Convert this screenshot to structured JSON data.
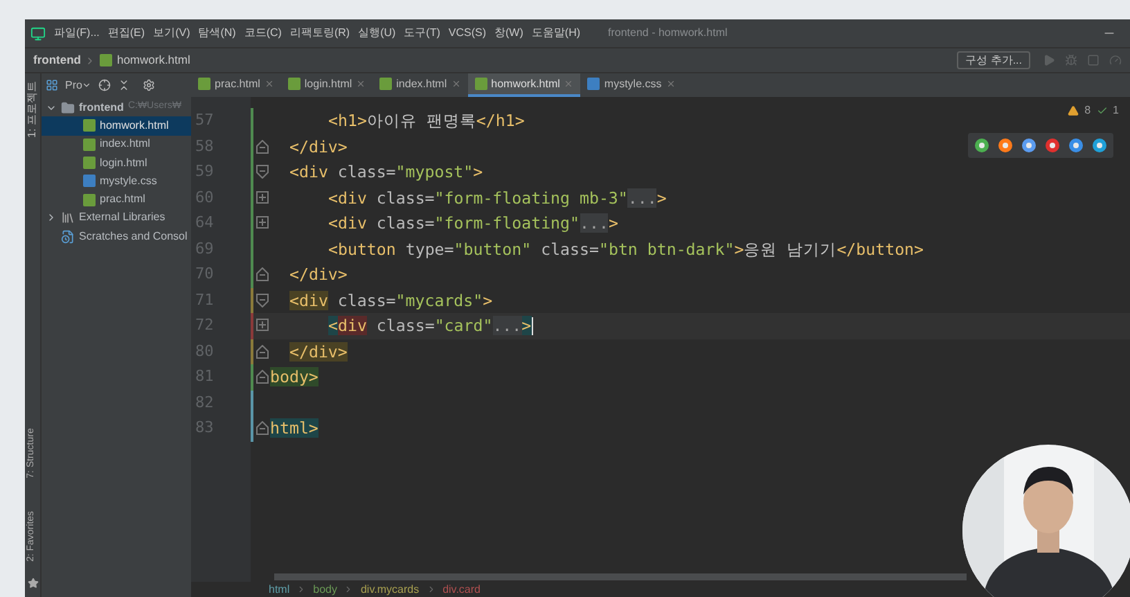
{
  "window": {
    "title": "frontend - homwork.html",
    "menu": [
      "파일(F)...",
      "편집(E)",
      "보기(V)",
      "탐색(N)",
      "코드(C)",
      "리팩토링(R)",
      "실행(U)",
      "도구(T)",
      "VCS(S)",
      "창(W)",
      "도움말(H)"
    ]
  },
  "breadcrumb": [
    "frontend",
    "homwork.html"
  ],
  "toolbar": {
    "config_button": "구성 추가..."
  },
  "tool_strip": {
    "top": "1: 프로젝트",
    "bottom": [
      "7: Structure",
      "2: Favorites"
    ]
  },
  "project": {
    "view_label": "Pro",
    "tree": [
      {
        "label": "frontend",
        "path": "C:₩Users₩",
        "kind": "folder",
        "expanded": true,
        "selected": false,
        "children": [
          {
            "label": "homwork.html",
            "kind": "html",
            "selected": true
          },
          {
            "label": "index.html",
            "kind": "html",
            "selected": false
          },
          {
            "label": "login.html",
            "kind": "html",
            "selected": false
          },
          {
            "label": "mystyle.css",
            "kind": "css",
            "selected": false
          },
          {
            "label": "prac.html",
            "kind": "html",
            "selected": false
          }
        ]
      },
      {
        "label": "External Libraries",
        "kind": "library",
        "expanded": false,
        "selected": false
      },
      {
        "label": "Scratches and Consol",
        "kind": "scratch",
        "selected": false
      }
    ]
  },
  "tabs": [
    {
      "label": "prac.html",
      "kind": "html",
      "selected": false
    },
    {
      "label": "login.html",
      "kind": "html",
      "selected": false
    },
    {
      "label": "index.html",
      "kind": "html",
      "selected": false
    },
    {
      "label": "homwork.html",
      "kind": "html",
      "selected": true
    },
    {
      "label": "mystyle.css",
      "kind": "css",
      "selected": false
    }
  ],
  "inspections": {
    "warnings": "8",
    "checks": "1"
  },
  "code": [
    {
      "number": "57",
      "indent": {
        "kind": "inner"
      },
      "change_bar": {
        "color": "#4f8a4f"
      },
      "current": false,
      "tokens": [
        {
          "kind": "tag",
          "text": "<h1>"
        },
        {
          "kind": "text",
          "text": "아이유 팬명록"
        },
        {
          "kind": "tag",
          "text": "</h1>"
        }
      ]
    },
    {
      "number": "58",
      "indent": {
        "kind": "outer"
      },
      "fold": {
        "kind": "end"
      },
      "change_bar": {
        "color": "#4f8a4f"
      },
      "current": false,
      "tokens": [
        {
          "kind": "tag",
          "text": "</div>"
        }
      ]
    },
    {
      "number": "59",
      "indent": {
        "kind": "outer"
      },
      "fold": {
        "kind": "start"
      },
      "change_bar": {
        "color": "#4f8a4f"
      },
      "current": false,
      "tokens": [
        {
          "kind": "tag",
          "text": "<div"
        },
        {
          "kind": "attr",
          "text": " class="
        },
        {
          "kind": "string",
          "text": "\"mypost\""
        },
        {
          "kind": "tag",
          "text": ">"
        }
      ]
    },
    {
      "number": "60",
      "indent": {
        "kind": "inner"
      },
      "fold": {
        "kind": "collapsed"
      },
      "change_bar": {
        "color": "#4f8a4f"
      },
      "current": false,
      "tokens": [
        {
          "kind": "tag",
          "text": "<div"
        },
        {
          "kind": "attr",
          "text": " class="
        },
        {
          "kind": "string",
          "text": "\"form-floating mb-3\""
        },
        {
          "kind": "fold",
          "text": "..."
        },
        {
          "kind": "tag",
          "text": ">"
        }
      ]
    },
    {
      "number": "64",
      "indent": {
        "kind": "inner"
      },
      "fold": {
        "kind": "collapsed"
      },
      "change_bar": {
        "color": "#4f8a4f"
      },
      "current": false,
      "tokens": [
        {
          "kind": "tag",
          "text": "<div"
        },
        {
          "kind": "attr",
          "text": " class="
        },
        {
          "kind": "string",
          "text": "\"form-floating\""
        },
        {
          "kind": "fold",
          "text": "..."
        },
        {
          "kind": "tag",
          "text": ">"
        }
      ]
    },
    {
      "number": "69",
      "indent": {
        "kind": "inner"
      },
      "change_bar": {
        "color": "#4f8a4f"
      },
      "current": false,
      "tokens": [
        {
          "kind": "tag",
          "text": "<button"
        },
        {
          "kind": "attr",
          "text": " type="
        },
        {
          "kind": "string",
          "text": "\"button\""
        },
        {
          "kind": "attr",
          "text": " class="
        },
        {
          "kind": "string",
          "text": "\"btn btn-dark\""
        },
        {
          "kind": "tag",
          "text": ">"
        },
        {
          "kind": "text",
          "text": "응원 남기기"
        },
        {
          "kind": "tag",
          "text": "</button>"
        }
      ]
    },
    {
      "number": "70",
      "indent": {
        "kind": "outer"
      },
      "fold": {
        "kind": "end"
      },
      "change_bar": {
        "color": "#4f8a4f"
      },
      "current": false,
      "tokens": [
        {
          "kind": "tag",
          "text": "</div>"
        }
      ]
    },
    {
      "number": "71",
      "indent": {
        "kind": "outer"
      },
      "fold": {
        "kind": "start"
      },
      "change_bar": {
        "color": "#8a7a3a"
      },
      "current": false,
      "tokens": [
        {
          "kind": "tag",
          "text": "<div",
          "color": "#4a4224"
        },
        {
          "kind": "attr",
          "text": " class="
        },
        {
          "kind": "string",
          "text": "\"mycards\""
        },
        {
          "kind": "tag",
          "text": ">"
        }
      ]
    },
    {
      "number": "72",
      "indent": {
        "kind": "inner"
      },
      "fold": {
        "kind": "collapsed"
      },
      "change_bar": {
        "color": "#8a3a3a"
      },
      "current": true,
      "tokens": [
        {
          "kind": "tag",
          "text": "<",
          "color": "#1e4548"
        },
        {
          "kind": "tag",
          "text": "div",
          "color": "#5a2a2a"
        },
        {
          "kind": "attr",
          "text": " class="
        },
        {
          "kind": "string",
          "text": "\"card\""
        },
        {
          "kind": "fold",
          "text": "..."
        },
        {
          "kind": "tag",
          "text": ">",
          "color": "#1e4548"
        }
      ]
    },
    {
      "number": "80",
      "indent": {
        "kind": "outer"
      },
      "fold": {
        "kind": "end"
      },
      "change_bar": {
        "color": "#8a7a3a"
      },
      "current": false,
      "tokens": [
        {
          "kind": "tag",
          "text": "</div>",
          "color": "#4a4224"
        }
      ]
    },
    {
      "number": "81",
      "fold": {
        "kind": "end"
      },
      "change_bar": {
        "color": "#4f8a4f"
      },
      "current": false,
      "tokens": [
        {
          "kind": "tag",
          "text": "body>",
          "color": "#2f4a2a"
        }
      ]
    },
    {
      "number": "82",
      "change_bar": {
        "color": "#5a95a8"
      },
      "current": false
    },
    {
      "number": "83",
      "fold": {
        "kind": "end"
      },
      "change_bar": {
        "color": "#5a95a8"
      },
      "current": false,
      "tokens": [
        {
          "kind": "tag",
          "text": "html>",
          "color": "#1e4548"
        }
      ]
    }
  ],
  "status_path": [
    {
      "label": "html",
      "color": "#5f9ea8"
    },
    {
      "label": "body",
      "color": "#6a9955"
    },
    {
      "label": "div.mycards",
      "color": "#a8a050"
    },
    {
      "label": "div.card",
      "color": "#b05050"
    }
  ],
  "webcam": {
    "kind": "picture"
  }
}
